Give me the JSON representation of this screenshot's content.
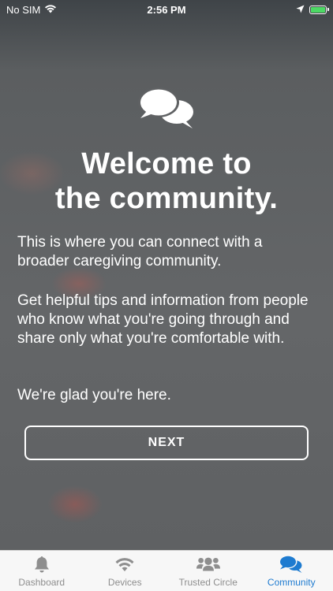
{
  "status_bar": {
    "carrier": "No SIM",
    "time": "2:56 PM",
    "battery_color": "#4cd964",
    "icons": [
      "wifi-icon",
      "location-arrow-icon",
      "battery-charging-icon"
    ]
  },
  "main": {
    "icon": "speech-bubbles-icon",
    "title_line1": "Welcome to",
    "title_line2": "the community.",
    "paragraph1": "This is where you can connect with a broader caregiving community.",
    "paragraph2": "Get helpful tips and information from people who know what you're going through and share only what you're comfortable with.",
    "paragraph3": "We're glad you're here.",
    "next_label": "NEXT"
  },
  "tab_bar": {
    "active_color": "#1e7bd0",
    "inactive_color": "#8e8e8e",
    "items": [
      {
        "label": "Dashboard",
        "icon": "bell-icon",
        "active": false
      },
      {
        "label": "Devices",
        "icon": "wifi-icon",
        "active": false
      },
      {
        "label": "Trusted Circle",
        "icon": "users-icon",
        "active": false
      },
      {
        "label": "Community",
        "icon": "comments-icon",
        "active": true
      }
    ]
  }
}
